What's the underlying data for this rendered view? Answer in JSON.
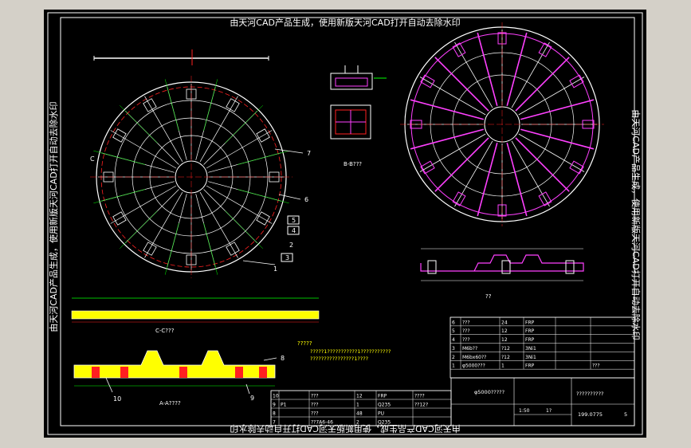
{
  "watermark_top": "由天河CAD产品生成，使用新版天河CAD打开自动去除水印",
  "watermark_bottom": "由天河CAD产品生成，使用新版天河CAD打开自动去除水印",
  "watermark_left": "由天河CAD产品生成，使用新版天河CAD打开自动去除水印",
  "watermark_right": "由天河CAD产品生成，使用新版天河CAD打开自动去除水印",
  "labels": {
    "section_b": "B-B???",
    "section_c": "C-C???",
    "section_a": "A-A????",
    "detail_1": "??",
    "note_head": "?????",
    "note_line1": "?????1???????????1???????????",
    "note_line2": "????????????????1????",
    "leaders": [
      "1",
      "2",
      "3",
      "4",
      "5",
      "6",
      "7",
      "8",
      "9",
      "10"
    ],
    "c_mark": "C"
  },
  "colors": {
    "background": "#000000",
    "frame": "#ffffff",
    "red": "#ff2020",
    "magenta": "#ff40ff",
    "yellow": "#ffff00",
    "cyan": "#00ffff",
    "green": "#00ff00",
    "window": "#d4d0c8"
  },
  "bom_rows": [
    [
      "6",
      "???",
      "24",
      "FRP",
      "",
      ""
    ],
    [
      "5",
      "???",
      "12",
      "FRP",
      "",
      ""
    ],
    [
      "4",
      "???",
      "12",
      "FRP",
      "",
      ""
    ],
    [
      "3",
      "M6b??",
      "?12",
      "3Ni1",
      "",
      ""
    ],
    [
      "2",
      "M6bx60??",
      "?12",
      "3Ni1",
      "",
      ""
    ],
    [
      "1",
      "φ5000???",
      "1",
      "FRP",
      "",
      "???"
    ]
  ],
  "bom_rows_bottom": [
    [
      "10",
      "",
      "???",
      "12",
      "FRP",
      "????"
    ],
    [
      "9",
      "P1",
      "???",
      "1",
      "Q235",
      "??12?"
    ],
    [
      "8",
      "",
      "???",
      "48",
      "PU",
      ""
    ],
    [
      "7",
      "",
      "??7A6-46",
      "2",
      "Q235",
      ""
    ]
  ],
  "title_block": {
    "name": "φ5000?????",
    "drawing_no": "??????????",
    "code": "199.0775",
    "sheet": "5",
    "scale": "1:50",
    "qty": "1?"
  }
}
